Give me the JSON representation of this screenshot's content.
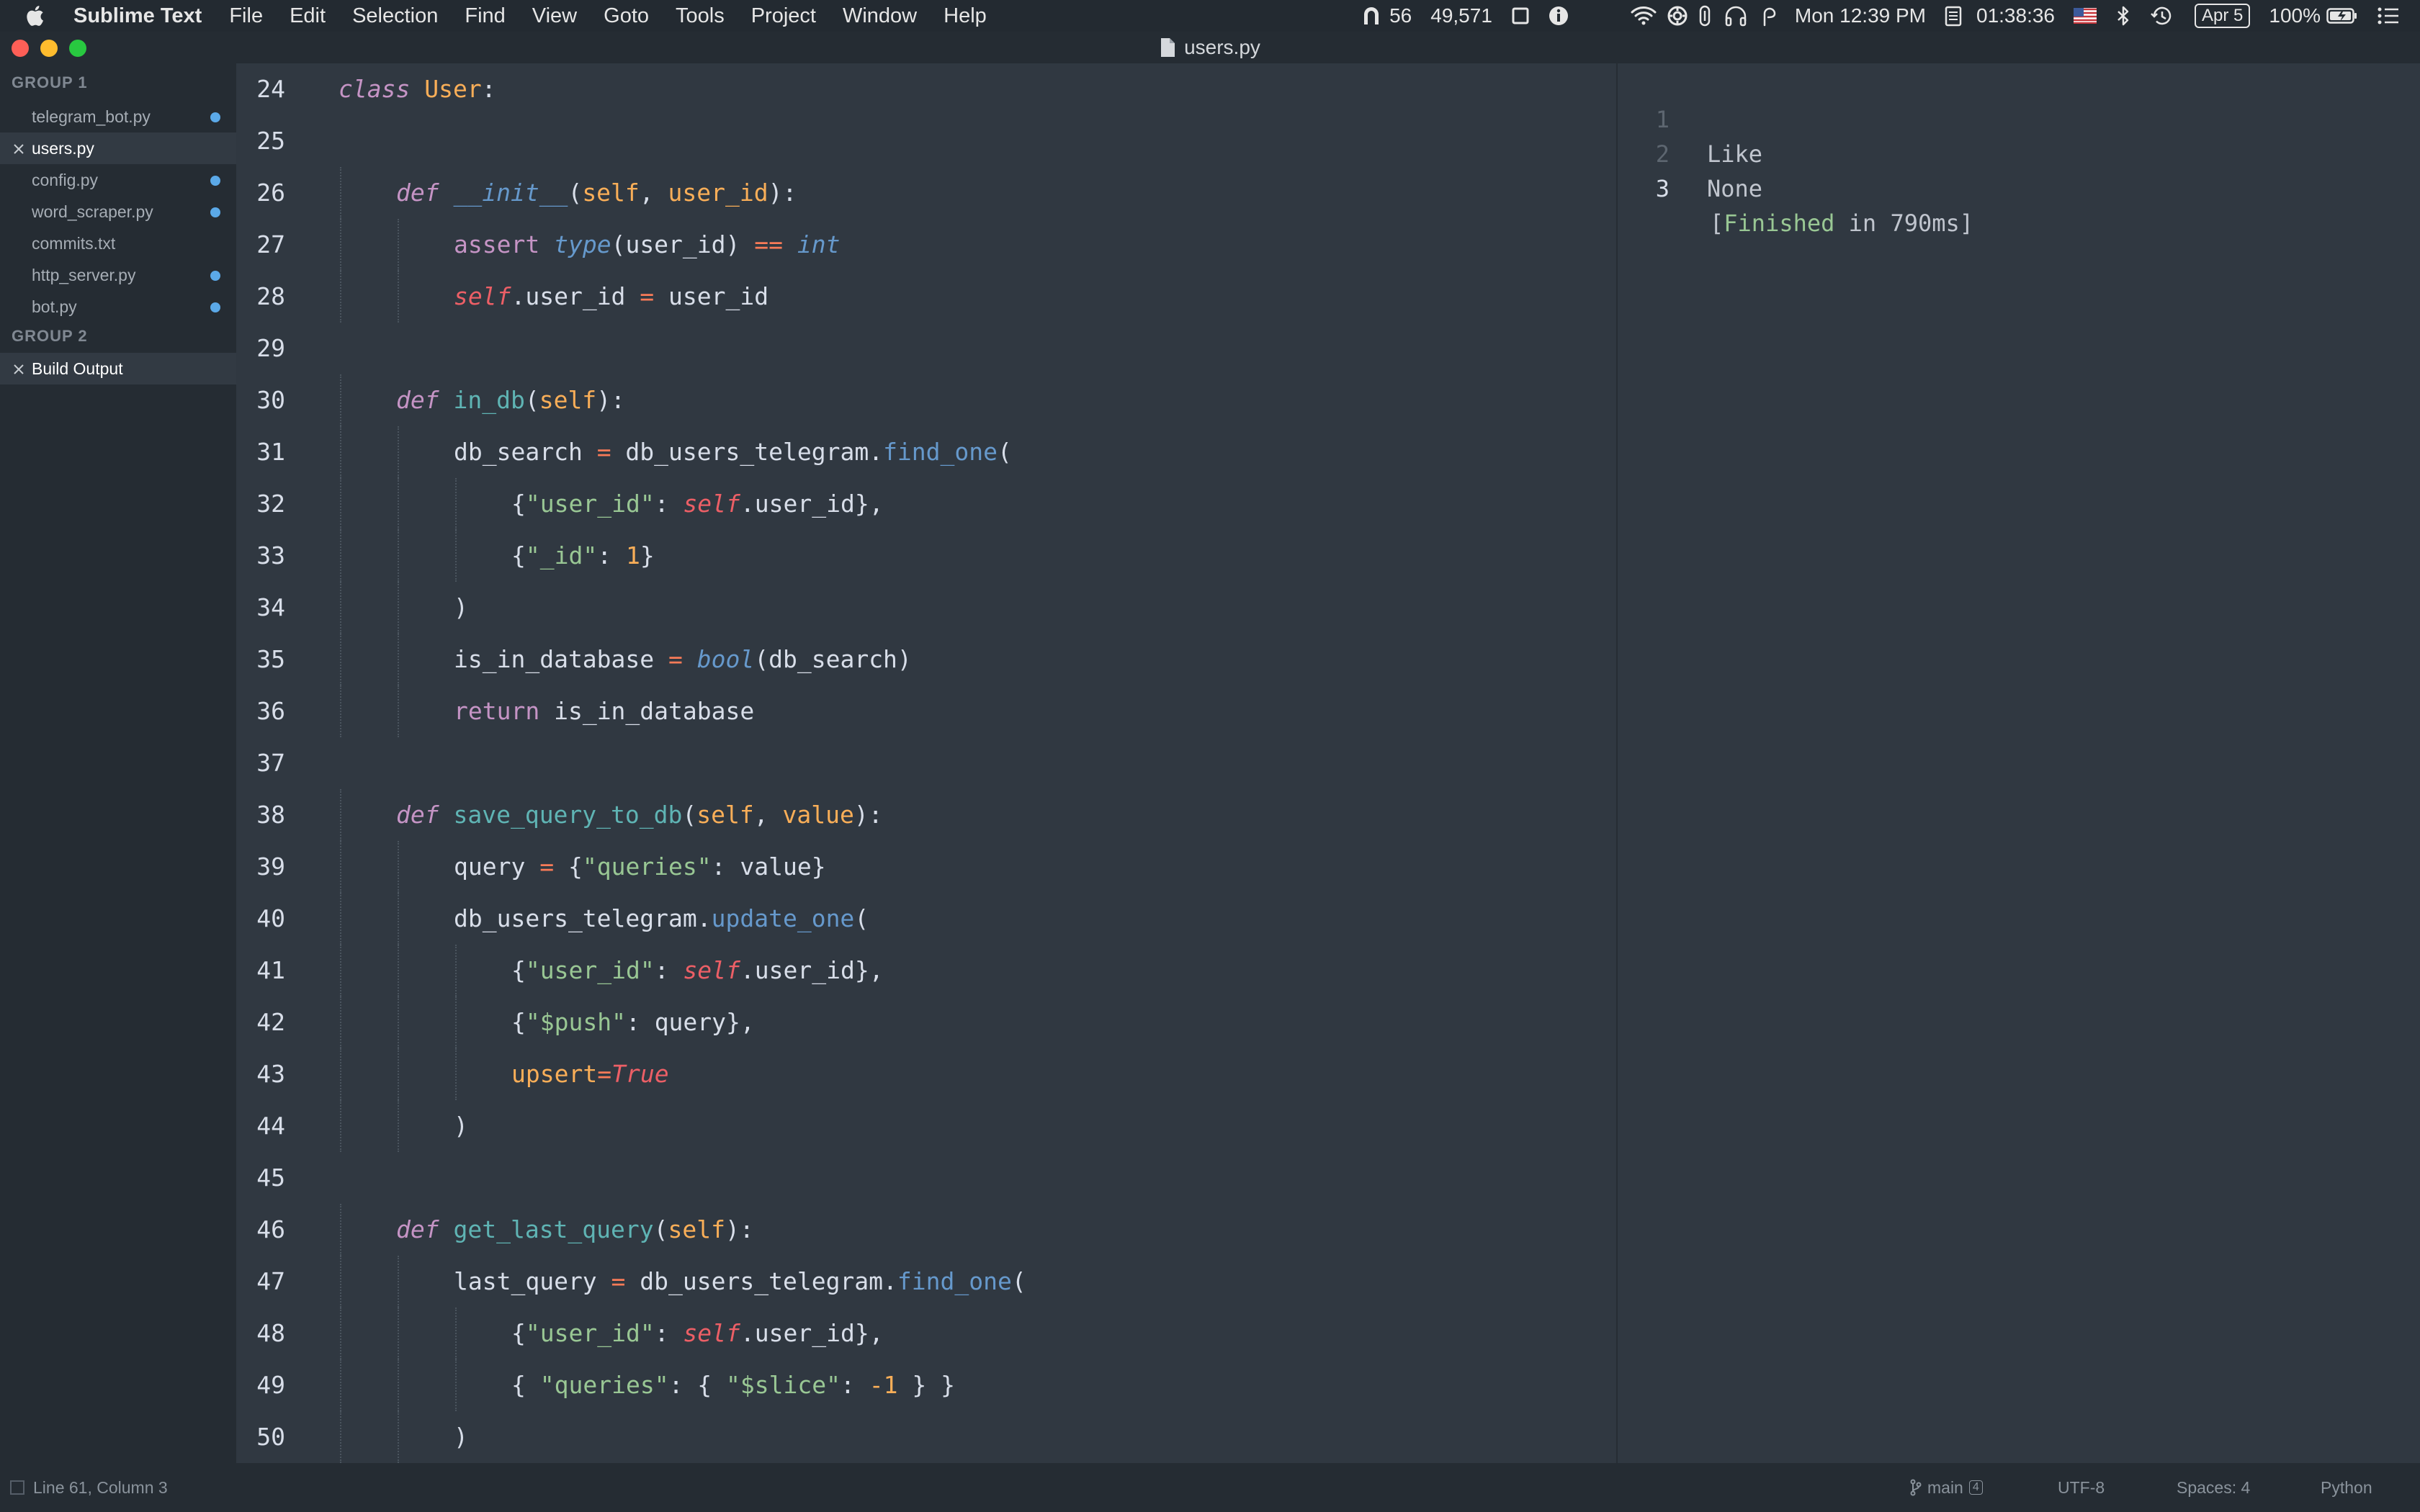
{
  "menubar": {
    "app_name": "Sublime Text",
    "menus": [
      "File",
      "Edit",
      "Selection",
      "Find",
      "View",
      "Goto",
      "Tools",
      "Project",
      "Window",
      "Help"
    ],
    "status": {
      "count_a": "56",
      "count_b": "49,571",
      "clock": "Mon 12:39 PM",
      "timer": "01:38:36",
      "date_badge": "Apr 5",
      "battery": "100%"
    }
  },
  "window": {
    "title": "users.py"
  },
  "sidebar": {
    "groups": [
      {
        "label": "GROUP 1",
        "files": [
          {
            "name": "telegram_bot.py",
            "modified": true,
            "active": false
          },
          {
            "name": "users.py",
            "modified": false,
            "active": true
          },
          {
            "name": "config.py",
            "modified": true,
            "active": false
          },
          {
            "name": "word_scraper.py",
            "modified": true,
            "active": false
          },
          {
            "name": "commits.txt",
            "modified": false,
            "active": false
          },
          {
            "name": "http_server.py",
            "modified": true,
            "active": false
          },
          {
            "name": "bot.py",
            "modified": true,
            "active": false
          }
        ]
      },
      {
        "label": "GROUP 2",
        "files": [
          {
            "name": "Build Output",
            "modified": false,
            "active": true
          }
        ]
      }
    ]
  },
  "editor": {
    "lines": [
      {
        "n": 24,
        "indent": 0,
        "tokens": [
          [
            "kw",
            "class"
          ],
          [
            "plain",
            " "
          ],
          [
            "cls",
            "User"
          ],
          [
            "plain",
            ":"
          ]
        ]
      },
      {
        "n": 25,
        "indent": 0,
        "tokens": []
      },
      {
        "n": 26,
        "indent": 1,
        "tokens": [
          [
            "kw",
            "def"
          ],
          [
            "plain",
            " "
          ],
          [
            "mag",
            "__init__"
          ],
          [
            "plain",
            "("
          ],
          [
            "param",
            "self"
          ],
          [
            "plain",
            ", "
          ],
          [
            "param",
            "user_id"
          ],
          [
            "plain",
            "):"
          ]
        ]
      },
      {
        "n": 27,
        "indent": 2,
        "tokens": [
          [
            "ret",
            "assert"
          ],
          [
            "plain",
            " "
          ],
          [
            "type",
            "type"
          ],
          [
            "plain",
            "(user_id) "
          ],
          [
            "op",
            "=="
          ],
          [
            "plain",
            " "
          ],
          [
            "type",
            "int"
          ]
        ]
      },
      {
        "n": 28,
        "indent": 2,
        "tokens": [
          [
            "self",
            "self"
          ],
          [
            "plain",
            ".user_id "
          ],
          [
            "op",
            "="
          ],
          [
            "plain",
            " user_id"
          ]
        ]
      },
      {
        "n": 29,
        "indent": 0,
        "tokens": []
      },
      {
        "n": 30,
        "indent": 1,
        "tokens": [
          [
            "kw",
            "def"
          ],
          [
            "plain",
            " "
          ],
          [
            "fn",
            "in_db"
          ],
          [
            "plain",
            "("
          ],
          [
            "param",
            "self"
          ],
          [
            "plain",
            "):"
          ]
        ]
      },
      {
        "n": 31,
        "indent": 2,
        "tokens": [
          [
            "plain",
            "db_search "
          ],
          [
            "op",
            "="
          ],
          [
            "plain",
            " db_users_telegram."
          ],
          [
            "meth",
            "find_one"
          ],
          [
            "plain",
            "("
          ]
        ]
      },
      {
        "n": 32,
        "indent": 3,
        "tokens": [
          [
            "plain",
            "{"
          ],
          [
            "str",
            "\"user_id\""
          ],
          [
            "plain",
            ": "
          ],
          [
            "self",
            "self"
          ],
          [
            "plain",
            ".user_id},"
          ]
        ]
      },
      {
        "n": 33,
        "indent": 3,
        "tokens": [
          [
            "plain",
            "{"
          ],
          [
            "str",
            "\"_id\""
          ],
          [
            "plain",
            ": "
          ],
          [
            "num",
            "1"
          ],
          [
            "plain",
            "}"
          ]
        ]
      },
      {
        "n": 34,
        "indent": 2,
        "tokens": [
          [
            "plain",
            ")"
          ]
        ]
      },
      {
        "n": 35,
        "indent": 2,
        "tokens": [
          [
            "plain",
            "is_in_database "
          ],
          [
            "op",
            "="
          ],
          [
            "plain",
            " "
          ],
          [
            "type",
            "bool"
          ],
          [
            "plain",
            "(db_search)"
          ]
        ]
      },
      {
        "n": 36,
        "indent": 2,
        "tokens": [
          [
            "ret",
            "return"
          ],
          [
            "plain",
            " is_in_database"
          ]
        ]
      },
      {
        "n": 37,
        "indent": 0,
        "tokens": []
      },
      {
        "n": 38,
        "indent": 1,
        "tokens": [
          [
            "kw",
            "def"
          ],
          [
            "plain",
            " "
          ],
          [
            "fn",
            "save_query_to_db"
          ],
          [
            "plain",
            "("
          ],
          [
            "param",
            "self"
          ],
          [
            "plain",
            ", "
          ],
          [
            "param",
            "value"
          ],
          [
            "plain",
            "):"
          ]
        ]
      },
      {
        "n": 39,
        "indent": 2,
        "tokens": [
          [
            "plain",
            "query "
          ],
          [
            "op",
            "="
          ],
          [
            "plain",
            " {"
          ],
          [
            "str",
            "\"queries\""
          ],
          [
            "plain",
            ": value}"
          ]
        ]
      },
      {
        "n": 40,
        "indent": 2,
        "tokens": [
          [
            "plain",
            "db_users_telegram."
          ],
          [
            "meth",
            "update_one"
          ],
          [
            "plain",
            "("
          ]
        ]
      },
      {
        "n": 41,
        "indent": 3,
        "tokens": [
          [
            "plain",
            "{"
          ],
          [
            "str",
            "\"user_id\""
          ],
          [
            "plain",
            ": "
          ],
          [
            "self",
            "self"
          ],
          [
            "plain",
            ".user_id},"
          ]
        ]
      },
      {
        "n": 42,
        "indent": 3,
        "tokens": [
          [
            "plain",
            "{"
          ],
          [
            "str",
            "\"$push\""
          ],
          [
            "plain",
            ": query},"
          ]
        ]
      },
      {
        "n": 43,
        "indent": 3,
        "tokens": [
          [
            "param",
            "upsert"
          ],
          [
            "op",
            "="
          ],
          [
            "const",
            "True"
          ]
        ]
      },
      {
        "n": 44,
        "indent": 2,
        "tokens": [
          [
            "plain",
            ")"
          ]
        ]
      },
      {
        "n": 45,
        "indent": 0,
        "tokens": []
      },
      {
        "n": 46,
        "indent": 1,
        "tokens": [
          [
            "kw",
            "def"
          ],
          [
            "plain",
            " "
          ],
          [
            "fn",
            "get_last_query"
          ],
          [
            "plain",
            "("
          ],
          [
            "param",
            "self"
          ],
          [
            "plain",
            "):"
          ]
        ]
      },
      {
        "n": 47,
        "indent": 2,
        "tokens": [
          [
            "plain",
            "last_query "
          ],
          [
            "op",
            "="
          ],
          [
            "plain",
            " db_users_telegram."
          ],
          [
            "meth",
            "find_one"
          ],
          [
            "plain",
            "("
          ]
        ]
      },
      {
        "n": 48,
        "indent": 3,
        "tokens": [
          [
            "plain",
            "{"
          ],
          [
            "str",
            "\"user_id\""
          ],
          [
            "plain",
            ": "
          ],
          [
            "self",
            "self"
          ],
          [
            "plain",
            ".user_id},"
          ]
        ]
      },
      {
        "n": 49,
        "indent": 3,
        "tokens": [
          [
            "plain",
            "{ "
          ],
          [
            "str",
            "\"queries\""
          ],
          [
            "plain",
            ": { "
          ],
          [
            "str",
            "\"$slice\""
          ],
          [
            "plain",
            ": "
          ],
          [
            "num",
            "-1"
          ],
          [
            "plain",
            " } }"
          ]
        ]
      },
      {
        "n": 50,
        "indent": 2,
        "tokens": [
          [
            "plain",
            ")"
          ]
        ]
      }
    ]
  },
  "output": {
    "lines": [
      {
        "n": "1",
        "text": "Like",
        "finished": false,
        "current": false
      },
      {
        "n": "2",
        "text": "None",
        "finished": false,
        "current": false
      },
      {
        "n": "3",
        "text_open": "[",
        "text_green": "Finished",
        "text_close": " in 790ms]",
        "finished": true,
        "current": true
      }
    ]
  },
  "statusbar": {
    "position": "Line 61, Column 3",
    "branch": "main",
    "branch_badge": "4",
    "encoding": "UTF-8",
    "indentation": "Spaces: 4",
    "syntax": "Python"
  }
}
